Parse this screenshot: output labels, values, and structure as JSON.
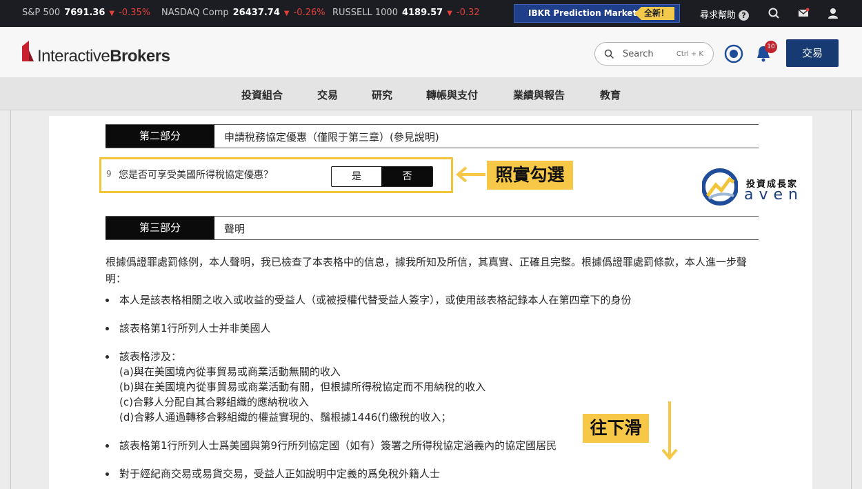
{
  "ticker": [
    {
      "name": "S&P 500",
      "value": "7691.36",
      "change": "-0.35%"
    },
    {
      "name": "NASDAQ Comp",
      "value": "26437.74",
      "change": "-0.26%"
    },
    {
      "name": "RUSSELL 1000",
      "value": "4189.57",
      "change": "-0.32"
    }
  ],
  "promo": {
    "label": "IBKR Prediction Markets",
    "badge": "全新！"
  },
  "top_right": {
    "help_label": "尋求幫助",
    "help_icon": "?"
  },
  "header": {
    "logo_light": "Interactive",
    "logo_bold": "Brokers",
    "search_placeholder": "Search",
    "search_shortcut": "Ctrl + K",
    "notification_count": "10",
    "trade_button": "交易"
  },
  "nav": [
    "投資組合",
    "交易",
    "研究",
    "轉帳與支付",
    "業績與報告",
    "教育"
  ],
  "part2": {
    "tag": "第二部分",
    "title": "申請稅務協定優惠（僅限于第三章）(參見說明)",
    "question_number": "9",
    "question": "您是否可享受美國所得稅協定優惠？",
    "yes": "是",
    "no": "否",
    "selected": "否"
  },
  "part3": {
    "tag": "第三部分",
    "title": "聲明",
    "paragraph": "根據僞證罪處罰條例，本人聲明，我已檢查了本表格中的信息，據我所知及所信，其真實、正確且完整。根據僞證罪處罰條款，本人進一步聲明：",
    "bullets": [
      "本人是該表格相關之收入或收益的受益人（或被授權代替受益人簽字），或使用該表格記錄本人在第四章下的身份",
      "該表格第1行所列人士并非美國人",
      "該表格涉及：",
      "該表格第1行所列人士爲美國與第9行所列協定國（如有）簽署之所得稅協定涵義內的協定國居民",
      "對于經紀商交易或易貨交易，受益人正如說明中定義的爲免稅外籍人士"
    ],
    "sub_items": [
      "(a)與在美國境內從事貿易或商業活動無關的收入",
      "(b)與在美國境內從事貿易或商業活動有關，但根據所得稅協定而不用納稅的收入",
      "(c)合夥人分配自其合夥組織的應納稅收入",
      "(d)合夥人通過轉移合夥組織的權益實現的、鬚根據1446(f)繳稅的收入；"
    ]
  },
  "annotations": {
    "check_label": "照實勾選",
    "scroll_label": "往下滑",
    "highlight_color": "#f7c847"
  },
  "watermark": {
    "cn": "投資成長家",
    "en": "aven"
  }
}
